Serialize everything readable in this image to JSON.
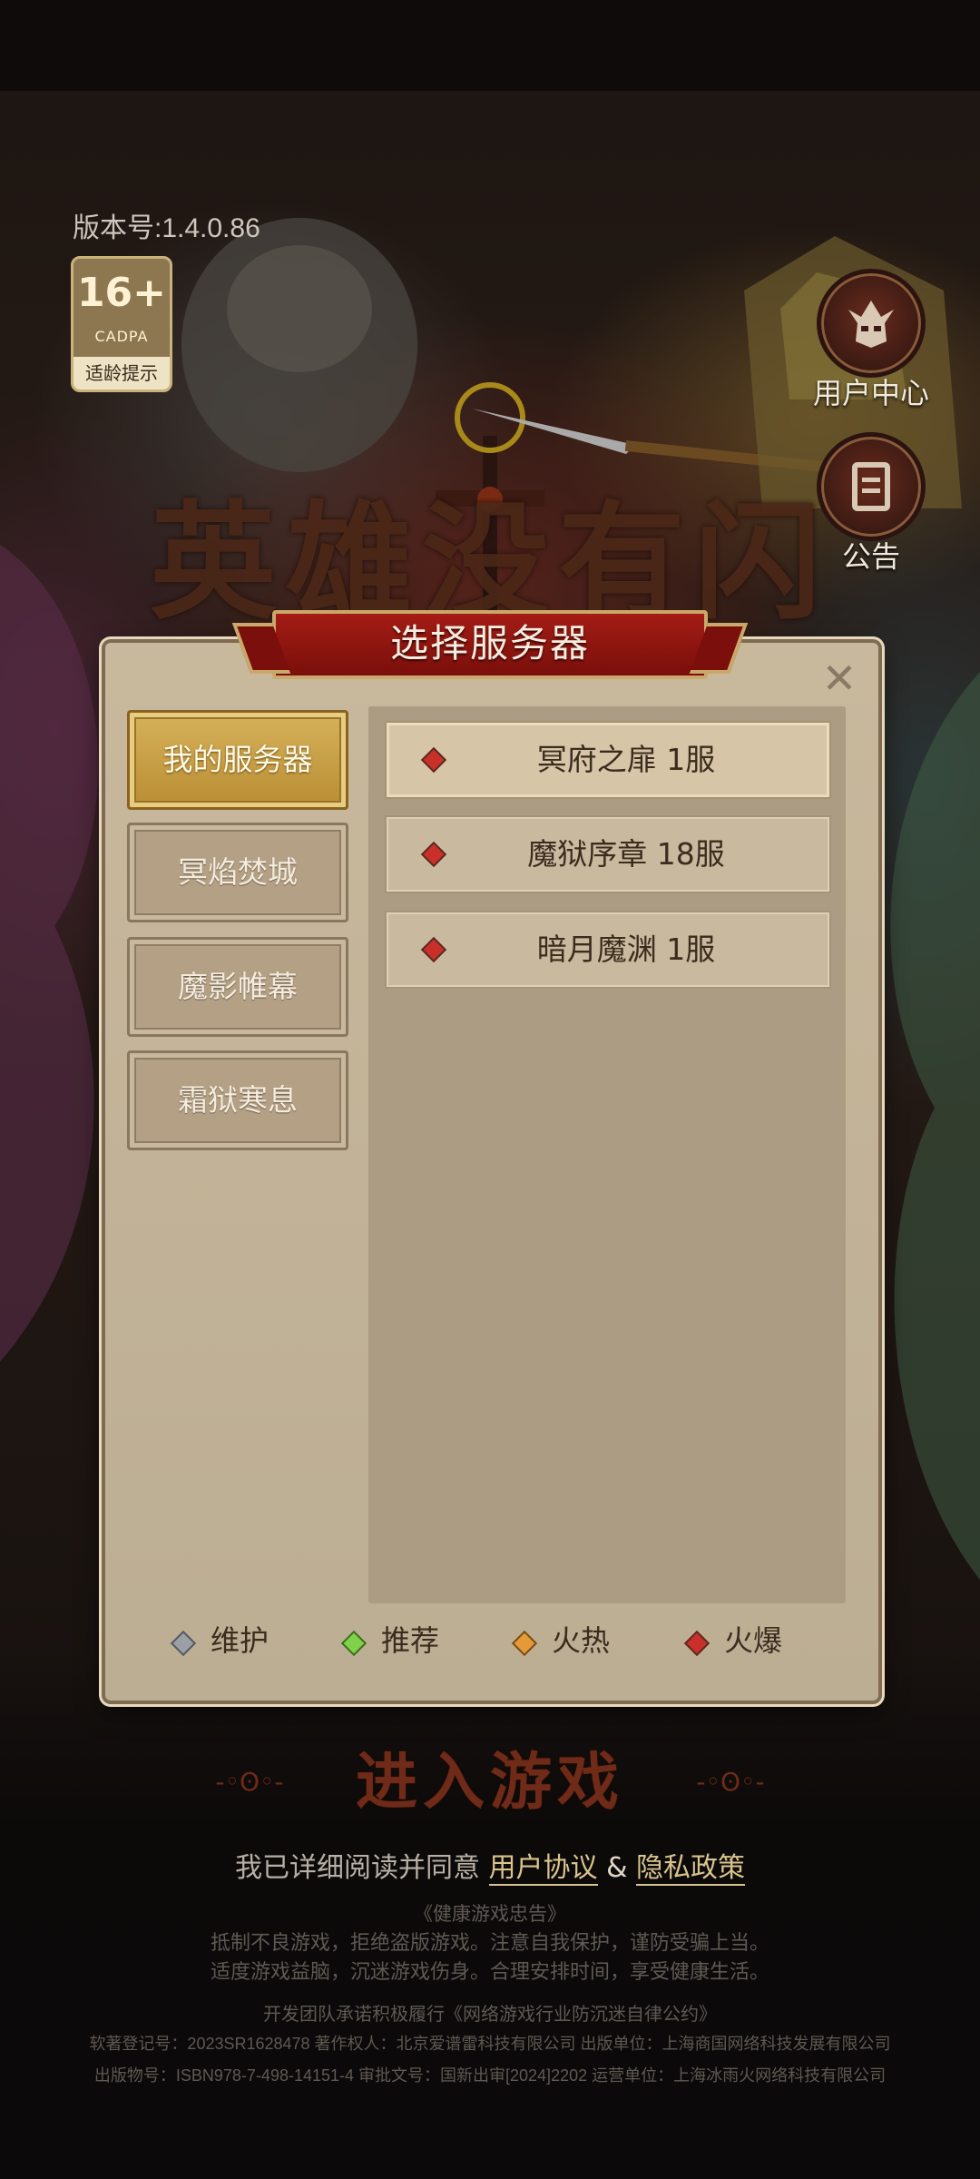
{
  "header": {
    "version": "版本号:1.4.0.86",
    "age_rating": {
      "number": "16+",
      "org": "CADPA",
      "tip": "适龄提示"
    }
  },
  "background": {
    "logo_text": "英雄没有闪"
  },
  "side_buttons": {
    "user_center": {
      "label": "用户中心",
      "icon": "helmet-icon"
    },
    "notice": {
      "label": "公告",
      "icon": "notice-icon"
    }
  },
  "dialog": {
    "title": "选择服务器",
    "close_icon": "close-icon",
    "categories": [
      {
        "label": "我的服务器",
        "active": true
      },
      {
        "label": "冥焰焚城",
        "active": false
      },
      {
        "label": "魔影帷幕",
        "active": false
      },
      {
        "label": "霜狱寒息",
        "active": false
      }
    ],
    "servers": [
      {
        "name": "冥府之扉 1服",
        "status": "火爆",
        "selected": true
      },
      {
        "name": "魔狱序章 18服",
        "status": "火爆",
        "selected": false
      },
      {
        "name": "暗月魔渊 1服",
        "status": "火爆",
        "selected": false
      }
    ],
    "legend": [
      {
        "label": "维护",
        "color": "#9aa0a6"
      },
      {
        "label": "推荐",
        "color": "#7fd14a"
      },
      {
        "label": "火热",
        "color": "#e59a3a"
      },
      {
        "label": "火爆",
        "color": "#c9302a"
      }
    ]
  },
  "enter_game": {
    "label": "进入游戏",
    "deco": "-◦ʘ◦-"
  },
  "agreement": {
    "prefix": "我已详细阅读并同意",
    "user_agreement": "用户协议",
    "amp": "&",
    "privacy_policy": "隐私政策"
  },
  "health_notice": {
    "title": "《健康游戏忠告》",
    "line1": "抵制不良游戏，拒绝盗版游戏。注意自我保护，谨防受骗上当。",
    "line2": "适度游戏益脑，沉迷游戏伤身。合理安排时间，享受健康生活。"
  },
  "legal": {
    "pledge": "开发团队承诺积极履行《网络游戏行业防沉迷自律公约》",
    "line1": "软著登记号：2023SR1628478  著作权人：北京爱谱雷科技有限公司  出版单位：上海商国网络科技发展有限公司",
    "line2": "出版物号：ISBN978-7-498-14151-4  审批文号：国新出审[2024]2202  运营单位：上海冰雨火网络科技有限公司"
  }
}
